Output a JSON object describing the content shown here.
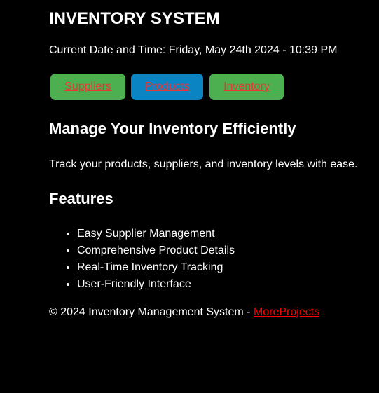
{
  "header": {
    "title": "INVENTORY SYSTEM",
    "datetime": "Current Date and Time: Friday, May 24th 2024 - 10:39 PM"
  },
  "nav": {
    "items": [
      {
        "label": "Suppliers",
        "bg_color": "#4caf50",
        "text_color": "#e53935"
      },
      {
        "label": "Products",
        "bg_color": "#0a84c3",
        "text_color": "#e53935"
      },
      {
        "label": "Inventory",
        "bg_color": "#4caf50",
        "text_color": "#e53935"
      }
    ]
  },
  "main": {
    "heading": "Manage Your Inventory Efficiently",
    "tagline": "Track your products, suppliers, and inventory levels with ease.",
    "features_heading": "Features",
    "features": [
      "Easy Supplier Management",
      "Comprehensive Product Details",
      "Real-Time Inventory Tracking",
      "User-Friendly Interface"
    ]
  },
  "footer": {
    "text": "© 2024 Inventory Management System - ",
    "link_label": "MoreProjects",
    "link_color": "#ff0000"
  },
  "colors": {
    "background": "#000000",
    "text": "#ffffff"
  }
}
